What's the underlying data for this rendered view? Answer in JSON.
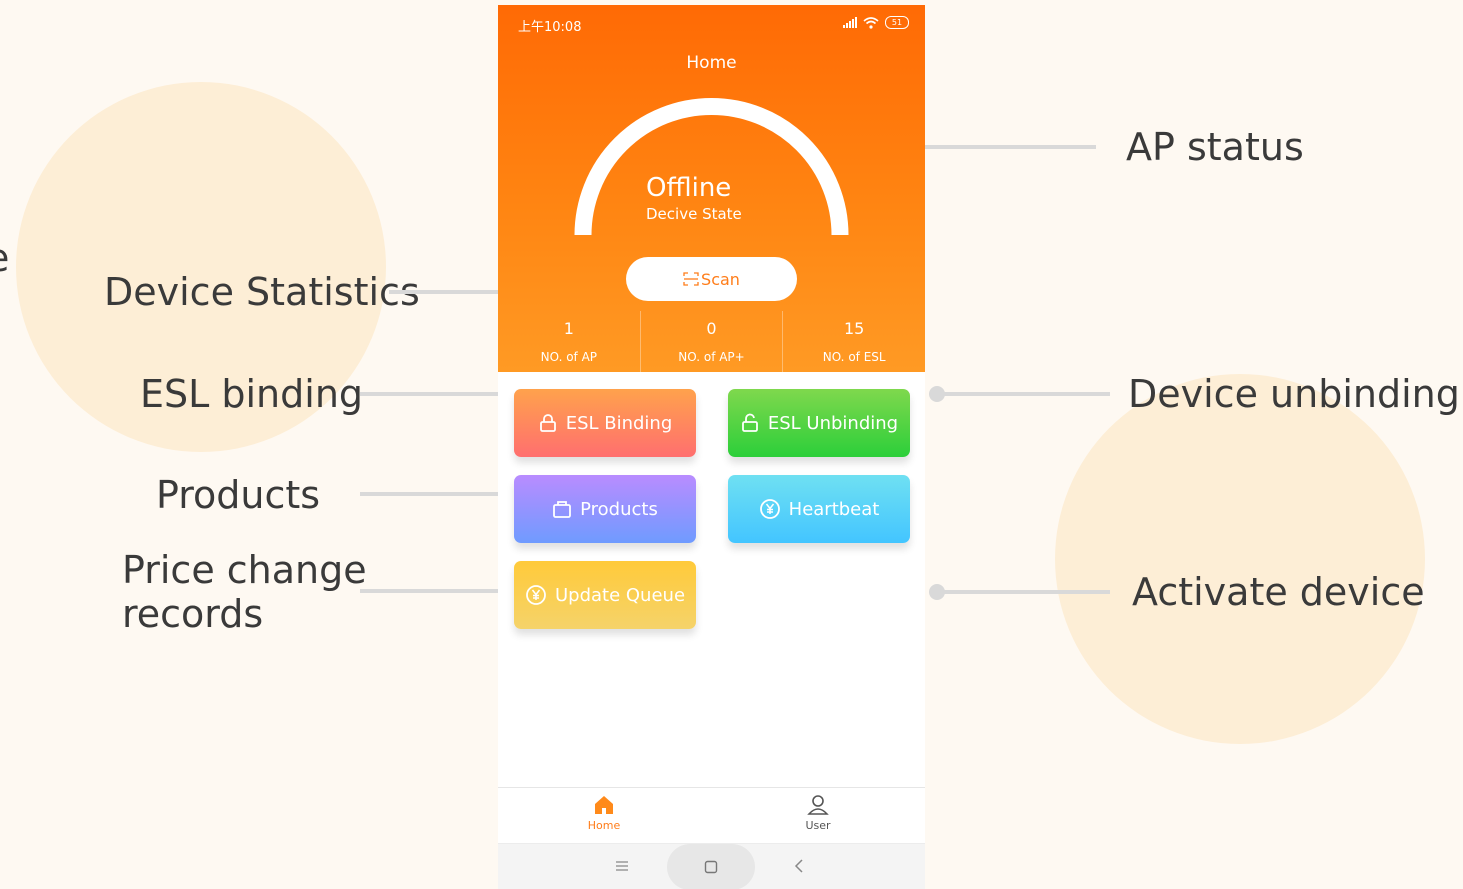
{
  "callouts": {
    "ap_status": "AP status",
    "device_statistics": "Device Statistics",
    "esl_binding": "ESL binding",
    "products": "Products",
    "price_change_line1": "Price change",
    "price_change_line2": "records",
    "device_unbinding": "Device unbinding",
    "activate_device": "Activate device",
    "edge_fragment": "e"
  },
  "status_bar": {
    "time": "上午10:08",
    "battery": "51"
  },
  "header": {
    "title": "Home",
    "gauge_state": "Offline",
    "gauge_subtitle": "Decive State",
    "scan_label": "Scan"
  },
  "stats": [
    {
      "value": "1",
      "label": "NO. of AP"
    },
    {
      "value": "0",
      "label": "NO. of AP+"
    },
    {
      "value": "15",
      "label": "NO. of ESL"
    }
  ],
  "tiles": {
    "esl_binding": {
      "label": "ESL Binding",
      "icon": "lock-icon"
    },
    "esl_unbinding": {
      "label": "ESL Unbinding",
      "icon": "unlock-icon"
    },
    "products": {
      "label": "Products",
      "icon": "shopping-bag-icon"
    },
    "heartbeat": {
      "label": "Heartbeat",
      "icon": "yen-coin-icon"
    },
    "update_queue": {
      "label": "Update Queue",
      "icon": "yen-coin-icon"
    }
  },
  "tabbar": {
    "home": "Home",
    "user": "User",
    "active_color": "#ff7d1a"
  },
  "colors": {
    "header_top": "#ff6a05",
    "header_bottom": "#ff9a24",
    "esl_binding": [
      "#ffa24c",
      "#ff6f6f"
    ],
    "esl_unbinding": [
      "#7fd84d",
      "#2ccf3a"
    ],
    "products": [
      "#b98cff",
      "#6f9bff"
    ],
    "heartbeat": [
      "#6fe0f2",
      "#43c5ff"
    ],
    "update_queue": [
      "#ffca3a",
      "#f5d36a"
    ]
  }
}
